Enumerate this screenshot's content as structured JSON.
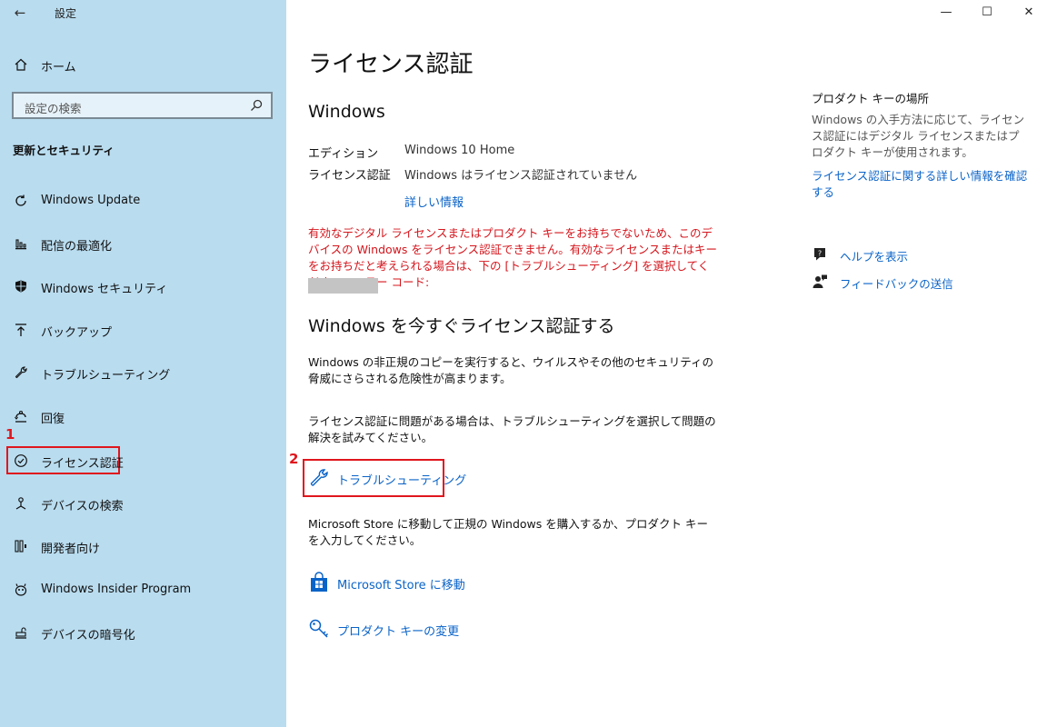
{
  "window": {
    "title": "設定",
    "back_icon": "←",
    "minimize_icon": "—",
    "maximize_icon": "☐",
    "close_icon": "✕"
  },
  "sidebar": {
    "home_label": "ホーム",
    "search_placeholder": "設定の検索",
    "section_title": "更新とセキュリティ",
    "items": [
      {
        "label": "Windows Update",
        "icon": "refresh-icon"
      },
      {
        "label": "配信の最適化",
        "icon": "delivery-icon"
      },
      {
        "label": "Windows セキュリティ",
        "icon": "shield-icon"
      },
      {
        "label": "バックアップ",
        "icon": "backup-icon"
      },
      {
        "label": "トラブルシューティング",
        "icon": "wrench-icon"
      },
      {
        "label": "回復",
        "icon": "recovery-icon"
      },
      {
        "label": "ライセンス認証",
        "icon": "check-circle-icon"
      },
      {
        "label": "デバイスの検索",
        "icon": "find-device-icon"
      },
      {
        "label": "開発者向け",
        "icon": "developer-icon"
      },
      {
        "label": "Windows Insider Program",
        "icon": "insider-icon"
      },
      {
        "label": "デバイスの暗号化",
        "icon": "encryption-icon"
      }
    ],
    "selected_index": 6,
    "marker_1": "1"
  },
  "main": {
    "page_title": "ライセンス認証",
    "windows_heading": "Windows",
    "edition_key": "エディション",
    "edition_value": "Windows 10 Home",
    "activation_key": "ライセンス認証",
    "activation_value": "Windows はライセンス認証されていません",
    "details_link": "詳しい情報",
    "error_text": "有効なデジタル ライセンスまたはプロダクト キーをお持ちでないため、このデバイスの Windows をライセンス認証できません。有効なライセンスまたはキーをお持ちだと考えられる場合は、下の [トラブルシューティング] を選択してください。エラー コード:",
    "activate_heading": "Windows を今すぐライセンス認証する",
    "body1": "Windows の非正規のコピーを実行すると、ウイルスやその他のセキュリティの脅威にさらされる危険性が高まります。",
    "body2": "ライセンス認証に問題がある場合は、トラブルシューティングを選択して問題の解決を試みてください。",
    "troubleshoot_label": "トラブルシューティング",
    "marker_2": "2",
    "body3": "Microsoft Store に移動して正規の Windows を購入するか、プロダクト キーを入力してください。",
    "store_label": "Microsoft Store に移動",
    "change_key_label": "プロダクト キーの変更"
  },
  "right": {
    "title": "プロダクト キーの場所",
    "description": "Windows の入手方法に応じて、ライセンス認証にはデジタル ライセンスまたはプロダクト キーが使用されます。",
    "more_info_link": "ライセンス認証に関する詳しい情報を確認する",
    "help_label": "ヘルプを表示",
    "feedback_label": "フィードバックの送信"
  },
  "colors": {
    "sidebar_bg": "#b9dcef",
    "link": "#0a63c8",
    "error": "#d4151c",
    "highlight": "#e0161d"
  }
}
